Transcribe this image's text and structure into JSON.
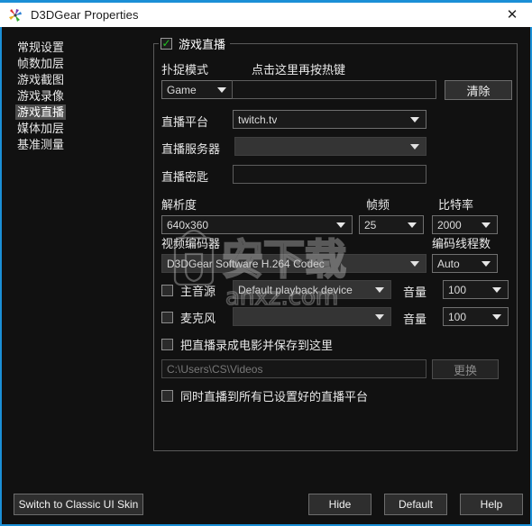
{
  "window": {
    "title": "D3DGear Properties",
    "close_label": "✕",
    "accent_color": "#1b8fd6",
    "titlebar_bg": "#ffffff",
    "body_bg": "#111111"
  },
  "sidebar": {
    "items": [
      {
        "label": "常规设置",
        "selected": false
      },
      {
        "label": "帧数加层",
        "selected": false
      },
      {
        "label": "游戏截图",
        "selected": false
      },
      {
        "label": "游戏录像",
        "selected": false
      },
      {
        "label": "游戏直播",
        "selected": true
      },
      {
        "label": "媒体加层",
        "selected": false
      },
      {
        "label": "基准测量",
        "selected": false
      }
    ]
  },
  "group": {
    "legend_label": "游戏直播",
    "legend_checked": true,
    "tick_glyph": "✓"
  },
  "form": {
    "capture_mode_label": "扑捉模式",
    "capture_mode_value": "Game",
    "hotkey_label": "点击这里再按热键",
    "hotkey_value": "",
    "clear_button": "清除",
    "platform_label": "直播平台",
    "platform_value": "twitch.tv",
    "server_label": "直播服务器",
    "server_value": "",
    "streamkey_label": "直播密匙",
    "streamkey_value": "",
    "resolution_label": "解析度",
    "resolution_value": "640x360",
    "framerate_label": "帧频",
    "framerate_value": "25",
    "bitrate_label": "比特率",
    "bitrate_value": "2000",
    "encoder_label": "视频编码器",
    "encoder_value": "D3DGear Software H.264 Codec",
    "threads_label": "编码线程数",
    "threads_value": "Auto",
    "mainaudio_label": "主音源",
    "mainaudio_checked": false,
    "mainaudio_device": "Default playback device",
    "mainaudio_volume_label": "音量",
    "mainaudio_volume_value": "100",
    "mic_label": "麦克风",
    "mic_checked": false,
    "mic_device": "",
    "mic_volume_label": "音量",
    "mic_volume_value": "100",
    "saverec_label": "把直播录成电影并保存到这里",
    "saverec_checked": false,
    "savepath_value": "C:\\Users\\CS\\Videos",
    "browse_button": "更换",
    "multistream_label": "同时直播到所有已设置好的直播平台",
    "multistream_checked": false
  },
  "footer": {
    "classic_skin_button": "Switch to Classic UI Skin",
    "hide_button": "Hide",
    "default_button": "Default",
    "help_button": "Help"
  },
  "watermark": {
    "text_cn": "安下载",
    "text_url": "anxz.com"
  }
}
